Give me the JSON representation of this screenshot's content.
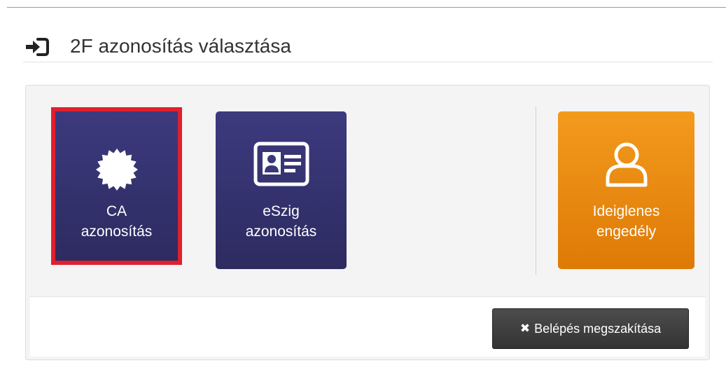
{
  "header": {
    "title": "2F azonosítás választása",
    "icon": "sign-in-icon"
  },
  "tiles": [
    {
      "line1": "CA",
      "line2": "azonosítás",
      "icon": "certificate-badge-icon",
      "selected": true,
      "color": "#3c3a7e"
    },
    {
      "line1": "eSzig",
      "line2": "azonosítás",
      "icon": "id-card-icon",
      "selected": false,
      "color": "#3c3a7e"
    },
    {
      "line1": "Ideiglenes",
      "line2": "engedély",
      "icon": "user-icon",
      "selected": false,
      "color": "#f39a1d"
    }
  ],
  "footer": {
    "cancel_icon": "✖",
    "cancel_label": "Belépés megszakítása"
  },
  "colors": {
    "navy": "#3c3a7e",
    "orange": "#f39a1d",
    "selection": "#e0202e",
    "cancel": "#3a3a3a"
  }
}
